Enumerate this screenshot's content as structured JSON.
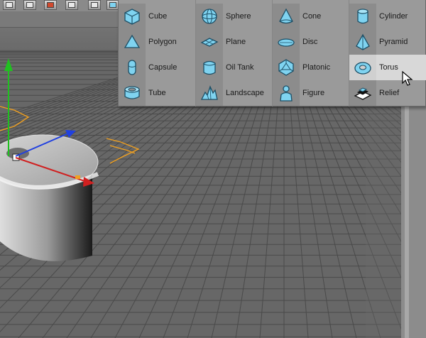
{
  "menu": {
    "items": [
      {
        "label": "Cube",
        "icon": "cube-icon"
      },
      {
        "label": "Sphere",
        "icon": "sphere-icon"
      },
      {
        "label": "Cone",
        "icon": "cone-icon"
      },
      {
        "label": "Cylinder",
        "icon": "cylinder-icon"
      },
      {
        "label": "Polygon",
        "icon": "polygon-icon"
      },
      {
        "label": "Plane",
        "icon": "plane-icon"
      },
      {
        "label": "Disc",
        "icon": "disc-icon"
      },
      {
        "label": "Pyramid",
        "icon": "pyramid-icon"
      },
      {
        "label": "Capsule",
        "icon": "capsule-icon"
      },
      {
        "label": "Oil Tank",
        "icon": "oil-tank-icon"
      },
      {
        "label": "Platonic",
        "icon": "platonic-icon"
      },
      {
        "label": "Torus",
        "icon": "torus-icon",
        "highlighted": true
      },
      {
        "label": "Tube",
        "icon": "tube-icon"
      },
      {
        "label": "Landscape",
        "icon": "landscape-icon"
      },
      {
        "label": "Figure",
        "icon": "figure-icon"
      },
      {
        "label": "Relief",
        "icon": "relief-icon"
      }
    ]
  },
  "colors": {
    "icon_fill": "#7fd3f0",
    "icon_stroke": "#1d4f66",
    "menu_bg": "#9a9a9a",
    "highlight_bg": "#d8d8d8",
    "grid_line": "#3f3f3f",
    "floor": "#6a6a6a",
    "spline": "#f0a020",
    "axis_x": "#d02020",
    "axis_y": "#20c020",
    "axis_z": "#2040e0"
  }
}
